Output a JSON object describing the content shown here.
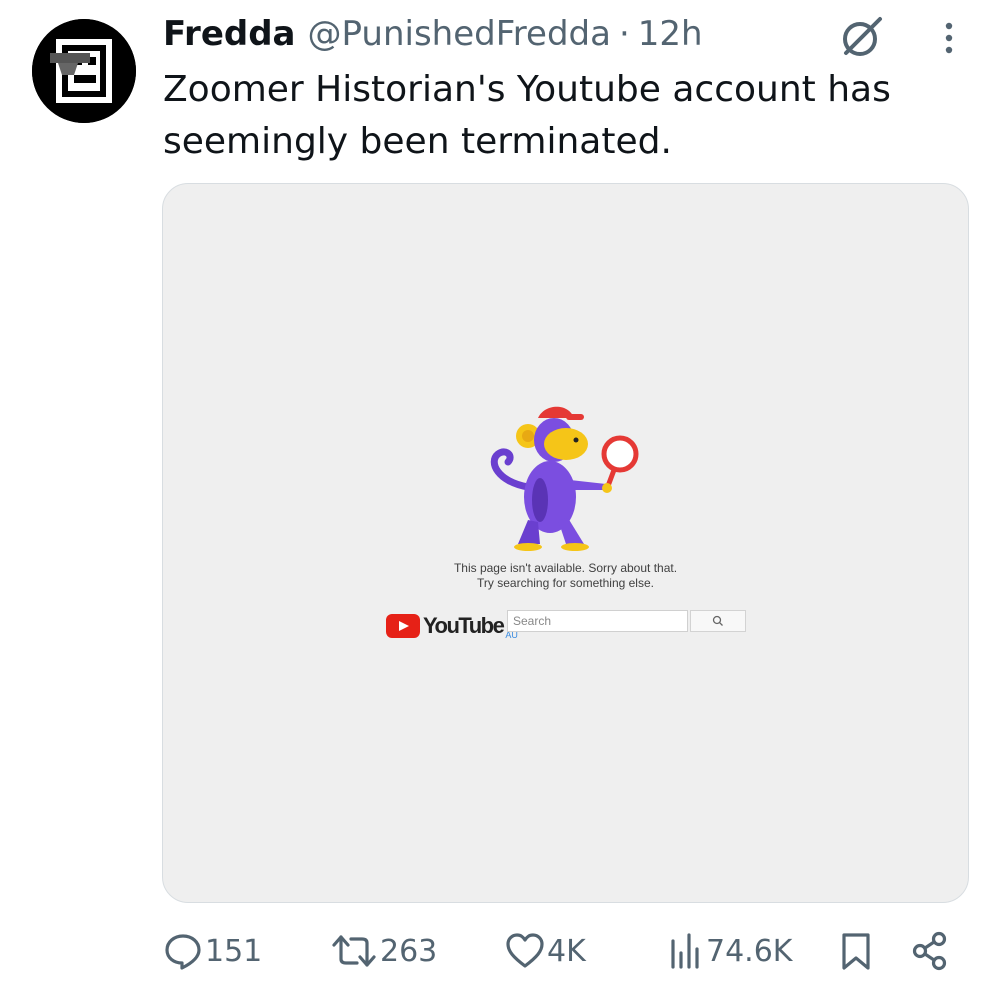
{
  "tweet": {
    "author_name": "Fredda",
    "author_handle": "@PunishedFredda",
    "separator": "·",
    "time": "12h",
    "text": "Zoomer Historian's Youtube account has seemingly been terminated."
  },
  "media": {
    "error_line_1": "This page isn't available. Sorry about that.",
    "error_line_2": "Try searching for something else.",
    "logo_text": "YouTube",
    "logo_region": "AU",
    "search_placeholder": "Search"
  },
  "actions": {
    "replies": "151",
    "reposts": "263",
    "likes": "4K",
    "views": "74.6K"
  },
  "icons": {
    "reply": "reply-icon",
    "repost": "repost-icon",
    "like": "heart-icon",
    "views": "analytics-icon",
    "bookmark": "bookmark-icon",
    "share": "share-icon",
    "grok": "grok-icon",
    "more": "more-vertical-icon"
  },
  "colors": {
    "secondary_text": "#536471",
    "youtube_red": "#e62117",
    "media_background": "#efefef"
  }
}
